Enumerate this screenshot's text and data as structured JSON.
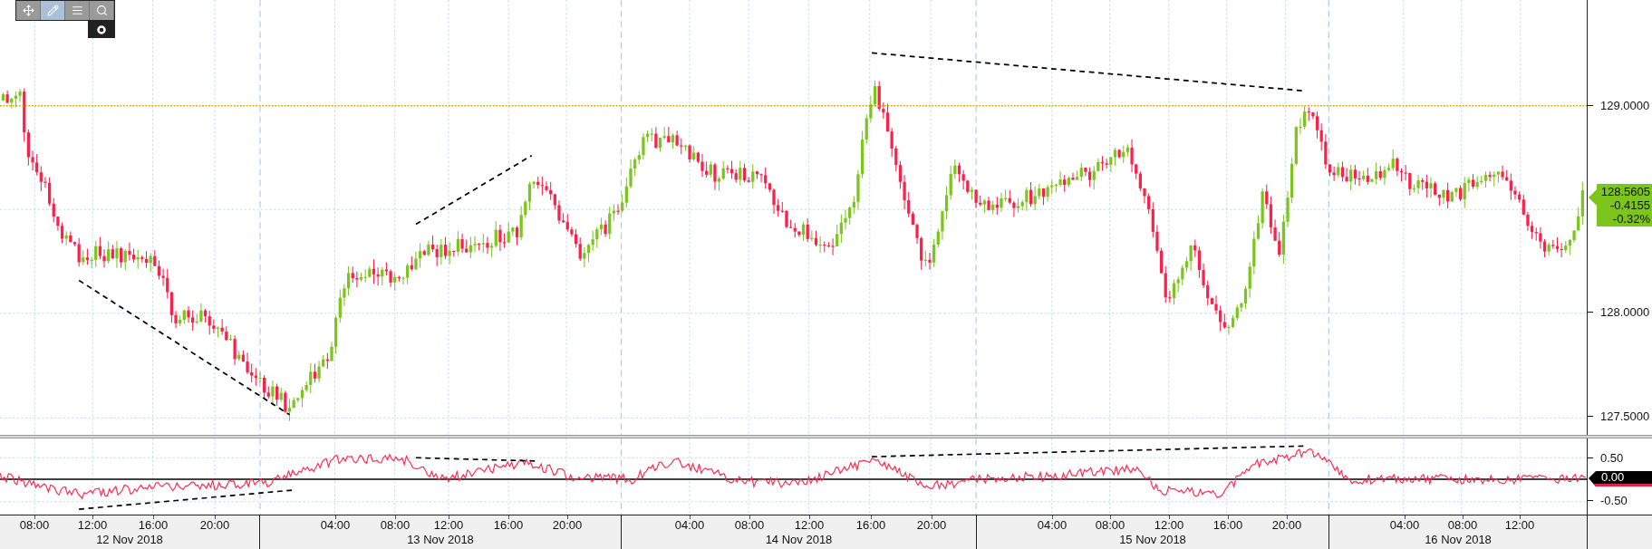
{
  "toolbar": {
    "buttons": [
      {
        "kind": "crosshair",
        "selected": false
      },
      {
        "kind": "draw",
        "selected": true
      },
      {
        "kind": "legend",
        "selected": false
      },
      {
        "kind": "zoom",
        "selected": false
      }
    ]
  },
  "price_axis": {
    "labels": [
      "129.0000",
      "128.0000",
      "127.5000"
    ],
    "last_price": {
      "price": "128.5605",
      "change": "-0.4155",
      "change_pct": "-0.32%"
    }
  },
  "oscillator_axis": {
    "labels": [
      "0.50",
      "-0.50"
    ],
    "zero_label": "0.00"
  },
  "time_axis": {
    "days": [
      {
        "date": "12 Nov 2018",
        "hours": [
          "08:00",
          "12:00",
          "16:00",
          "20:00"
        ]
      },
      {
        "date": "13 Nov 2018",
        "hours": [
          "04:00",
          "08:00",
          "12:00",
          "16:00",
          "20:00"
        ]
      },
      {
        "date": "14 Nov 2018",
        "hours": [
          "04:00",
          "08:00",
          "12:00",
          "16:00",
          "20:00"
        ]
      },
      {
        "date": "15 Nov 2018",
        "hours": [
          "04:00",
          "08:00",
          "12:00",
          "16:00",
          "20:00"
        ]
      },
      {
        "date": "16 Nov 2018",
        "hours": [
          "04:00",
          "08:00",
          "12:00"
        ]
      }
    ]
  }
}
